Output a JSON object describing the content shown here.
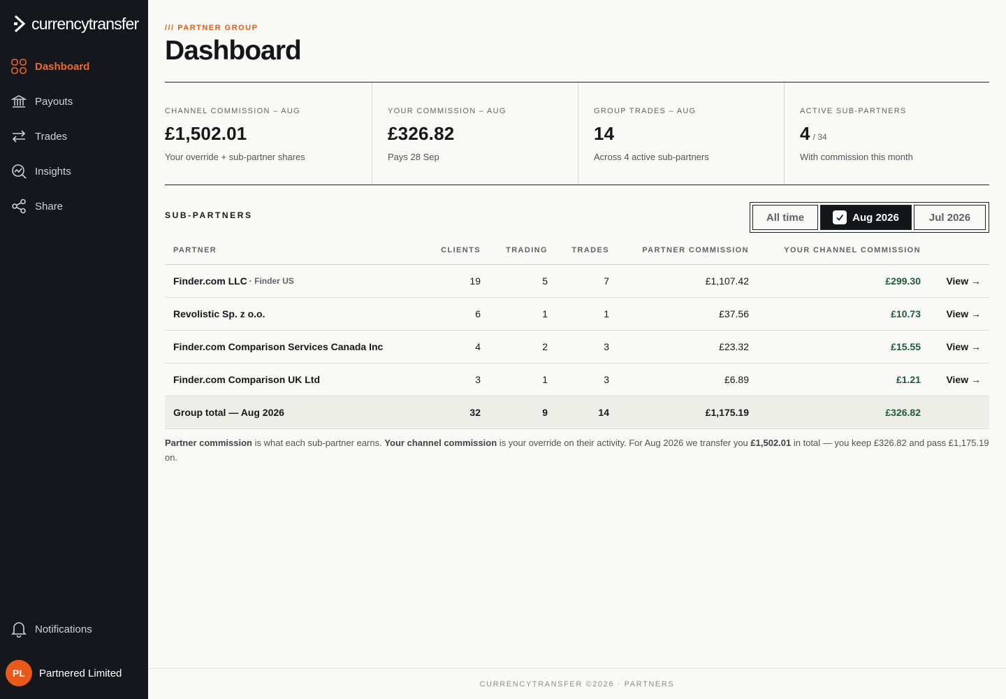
{
  "brand": {
    "name": "currencytransfer",
    "accent": "#ee6a25"
  },
  "sidebar": {
    "items": [
      {
        "label": "Dashboard",
        "icon": "grid-icon",
        "active": true
      },
      {
        "label": "Payouts",
        "icon": "bank-icon"
      },
      {
        "label": "Trades",
        "icon": "swap-arrows-icon"
      },
      {
        "label": "Insights",
        "icon": "chart-search-icon"
      },
      {
        "label": "Share",
        "icon": "share-icon"
      }
    ],
    "notifications": "Notifications",
    "user": {
      "initials": "PL",
      "name": "Partnered Limited"
    }
  },
  "header": {
    "eyebrow": "/// PARTNER GROUP",
    "title": "Dashboard"
  },
  "stats": [
    {
      "label": "CHANNEL COMMISSION – AUG",
      "value": "£1,502.01",
      "sub": "Your override + sub-partner shares"
    },
    {
      "label": "YOUR COMMISSION – AUG",
      "value": "£326.82",
      "sub": "Pays 28 Sep"
    },
    {
      "label": "GROUP TRADES – AUG",
      "value": "14",
      "sub": "Across 4 active sub-partners"
    },
    {
      "label": "ACTIVE SUB-PARTNERS",
      "value": "4",
      "value_suffix": "/ 34",
      "sub": "With commission this month"
    }
  ],
  "subpartners": {
    "title": "SUB-PARTNERS",
    "periods": [
      "All time",
      "Aug 2026",
      "Jul 2026"
    ],
    "selected_period": "Aug 2026",
    "columns": [
      "PARTNER",
      "CLIENTS",
      "TRADING",
      "TRADES",
      "PARTNER COMMISSION",
      "YOUR CHANNEL COMMISSION"
    ],
    "rows": [
      {
        "partner": "Finder.com LLC",
        "tag": "· Finder US",
        "clients": "19",
        "trading": "5",
        "trades": "7",
        "partner_commission": "£1,107.42",
        "channel_commission": "£299.30",
        "action": "View →"
      },
      {
        "partner": "Revolistic Sp. z o.o.",
        "tag": "",
        "clients": "6",
        "trading": "1",
        "trades": "1",
        "partner_commission": "£37.56",
        "channel_commission": "£10.73",
        "action": "View →"
      },
      {
        "partner": "Finder.com Comparison Services Canada Inc",
        "tag": "",
        "clients": "4",
        "trading": "2",
        "trades": "3",
        "partner_commission": "£23.32",
        "channel_commission": "£15.55",
        "action": "View →"
      },
      {
        "partner": "Finder.com Comparison UK Ltd",
        "tag": "",
        "clients": "3",
        "trading": "1",
        "trades": "3",
        "partner_commission": "£6.89",
        "channel_commission": "£1.21",
        "action": "View →"
      }
    ],
    "total": {
      "label": "Group total — Aug 2026",
      "clients": "32",
      "trading": "9",
      "trades": "14",
      "partner_commission": "£1,175.19",
      "channel_commission": "£326.82"
    }
  },
  "note": {
    "t1": "Partner commission",
    "t2": " is what each sub-partner earns. ",
    "t3": "Your channel commission",
    "t4": " is your override on their activity. For Aug 2026 we transfer you ",
    "t5": "£1,502.01",
    "t6": " in total — you keep £326.82 and pass £1,175.19 on."
  },
  "footer": "CURRENCYTRANSFER ©2026 · PARTNERS"
}
